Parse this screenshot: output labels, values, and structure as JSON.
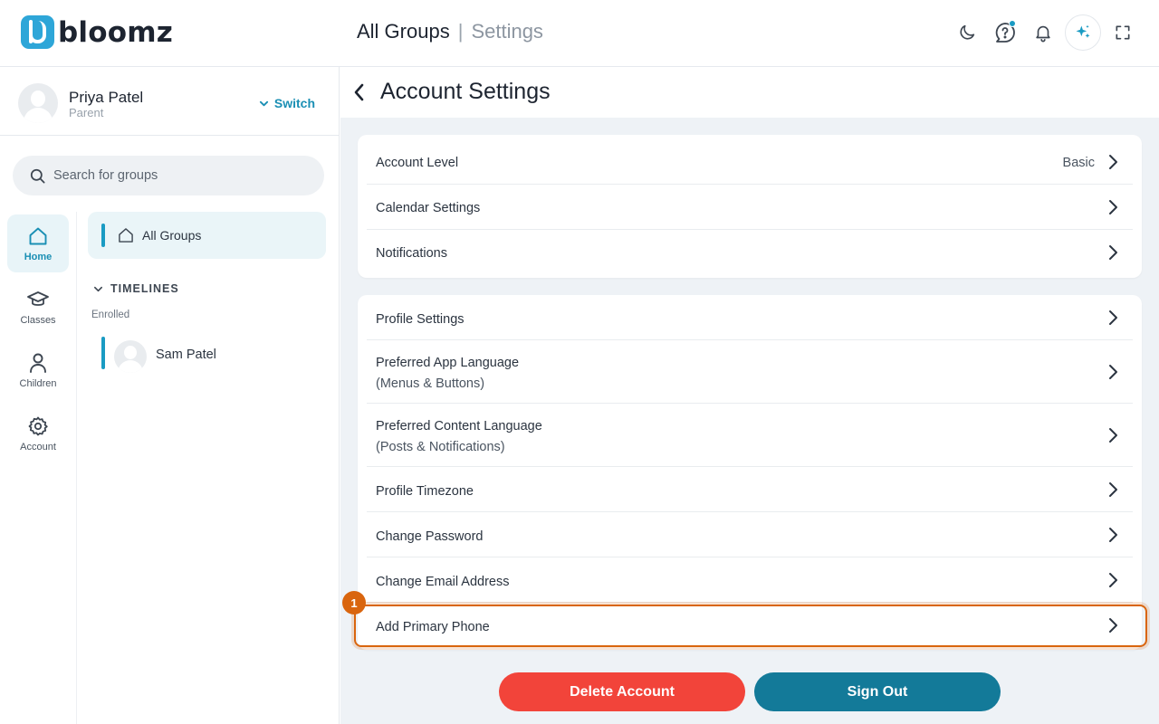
{
  "app": {
    "logo_text": "bloomz"
  },
  "header": {
    "breadcrumb_main": "All Groups",
    "breadcrumb_sep": "|",
    "breadcrumb_sub": "Settings",
    "icons": [
      "moon-icon",
      "help-chat-icon",
      "bell-icon",
      "ai-sparkle-icon",
      "fullscreen-icon"
    ]
  },
  "profile": {
    "name": "Priya Patel",
    "role": "Parent",
    "switch_label": "Switch"
  },
  "search": {
    "placeholder": "Search for groups"
  },
  "rail": [
    {
      "label": "Home",
      "icon": "home-icon",
      "active": true
    },
    {
      "label": "Classes",
      "icon": "graduation-cap-icon",
      "active": false
    },
    {
      "label": "Children",
      "icon": "person-icon",
      "active": false
    },
    {
      "label": "Account",
      "icon": "gear-icon",
      "active": false
    }
  ],
  "tree": {
    "all_groups": "All Groups",
    "timelines_label": "TIMELINES",
    "enrolled_label": "Enrolled",
    "child_name": "Sam Patel"
  },
  "main": {
    "title": "Account Settings",
    "card1": [
      {
        "label": "Account Level",
        "value": "Basic"
      },
      {
        "label": "Calendar Settings"
      },
      {
        "label": "Notifications"
      }
    ],
    "card2": [
      {
        "label": "Profile Settings"
      },
      {
        "label": "Preferred App Language",
        "sub": "(Menus & Buttons)"
      },
      {
        "label": "Preferred Content Language",
        "sub": "(Posts & Notifications)"
      },
      {
        "label": "Profile Timezone"
      },
      {
        "label": "Change Password"
      },
      {
        "label": "Change Email Address"
      },
      {
        "label": "Add Primary Phone"
      }
    ],
    "delete_label": "Delete Account",
    "signout_label": "Sign Out"
  },
  "annotation": {
    "marker": "1"
  },
  "colors": {
    "accent": "#1a9bc3",
    "danger": "#f2443a",
    "primary": "#137a99",
    "highlight": "#d9650e"
  }
}
